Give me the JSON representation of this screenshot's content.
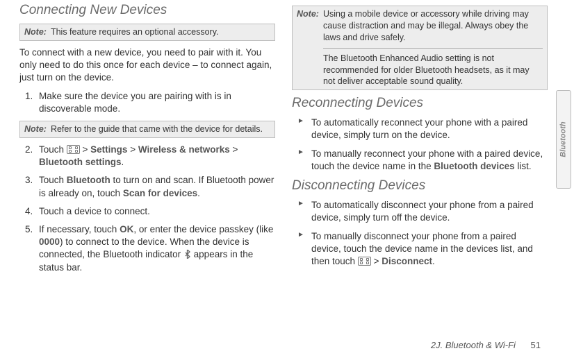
{
  "left": {
    "heading": "Connecting New Devices",
    "note1": {
      "label": "Note:",
      "body": "This feature requires an optional accessory."
    },
    "intro": "To connect with a new device, you need to pair with it. You only need to do this once for each device – to connect again, just turn on the device.",
    "step1": "Make sure the device you are pairing with is in discoverable mode.",
    "note2": {
      "label": "Note:",
      "body": "Refer to the guide that came with the device for details."
    },
    "step2": {
      "pre": "Touch ",
      "gt1": " > ",
      "settings": "Settings",
      "gt2": " > ",
      "wn": "Wireless & networks",
      "gt3": " > ",
      "bt": "Bluetooth settings",
      "post": "."
    },
    "step3": {
      "pre": "Touch ",
      "bt": "Bluetooth",
      "mid": " to turn on and scan. If Bluetooth power is already on, touch ",
      "scan": "Scan for devices",
      "post": "."
    },
    "step4": "Touch a device to connect.",
    "step5": {
      "pre": "If necessary, touch ",
      "ok": "OK",
      "mid1": ", or enter the device passkey (like ",
      "zeros": "0000",
      "mid2": ") to connect to the device. When the device is connected, the Bluetooth indicator ",
      "post": " appears in the status bar."
    }
  },
  "right": {
    "note": {
      "label": "Note:",
      "body1": "Using a mobile device or accessory while driving may cause distraction and may be illegal. Always obey the laws and drive safely.",
      "body2": "The Bluetooth Enhanced Audio setting is not recommended for older Bluetooth headsets, as it may not deliver acceptable sound quality."
    },
    "heading1": "Reconnecting Devices",
    "rec1": "To automatically reconnect your phone with a paired device, simply turn on the device.",
    "rec2": {
      "pre": "To manually reconnect your phone with a paired device, touch the device name in the ",
      "btdev": "Bluetooth devices",
      "post": " list."
    },
    "heading2": "Disconnecting Devices",
    "disc1": "To automatically disconnect your phone from a paired device, simply turn off the device.",
    "disc2": {
      "pre": "To manually disconnect your phone from a paired device, touch the device name in the devices list, and then touch ",
      "gt": " > ",
      "disconnect": "Disconnect",
      "post": "."
    }
  },
  "sideTab": "Bluetooth",
  "footer": {
    "section": "2J. Bluetooth & Wi-Fi",
    "page": "51"
  }
}
